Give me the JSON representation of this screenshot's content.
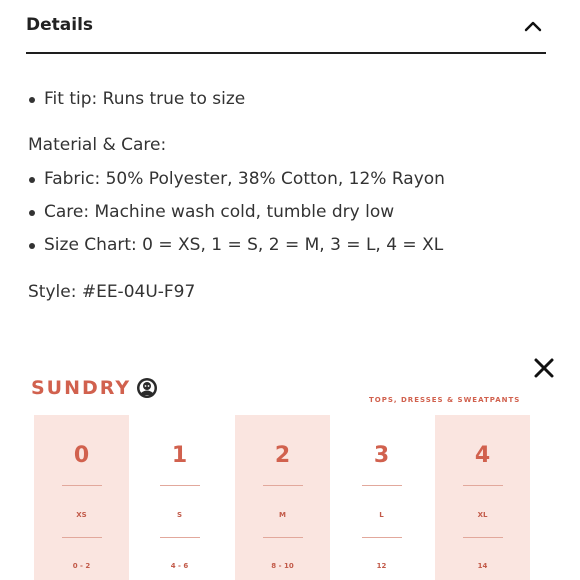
{
  "details": {
    "title": "Details",
    "fit_tip": "Fit tip: Runs true to size",
    "material_heading": "Material & Care:",
    "care_items": [
      "Fabric: 50% Polyester, 38% Cotton, 12% Rayon",
      "Care: Machine wash cold, tumble dry low",
      "Size Chart: 0 = XS, 1 = S, 2 = M, 3 = L, 4 = XL"
    ],
    "style": "Style: #EE-04U-F97"
  },
  "size_chart": {
    "brand": "SUNDRY",
    "subtitle": "TOPS, DRESSES & SWEATPANTS",
    "sizes": [
      {
        "num": "0",
        "label": "XS",
        "range": "0 - 2"
      },
      {
        "num": "1",
        "label": "S",
        "range": "4 - 6"
      },
      {
        "num": "2",
        "label": "M",
        "range": "8 - 10"
      },
      {
        "num": "3",
        "label": "L",
        "range": "12"
      },
      {
        "num": "4",
        "label": "XL",
        "range": "14"
      }
    ]
  },
  "icons": [
    "chevron-up-icon",
    "close-icon",
    "brand-logo-icon"
  ],
  "colors": {
    "accent": "#d1614e",
    "shade": "#fae5e0",
    "text": "#333333",
    "rule": "#1e1e1e"
  }
}
